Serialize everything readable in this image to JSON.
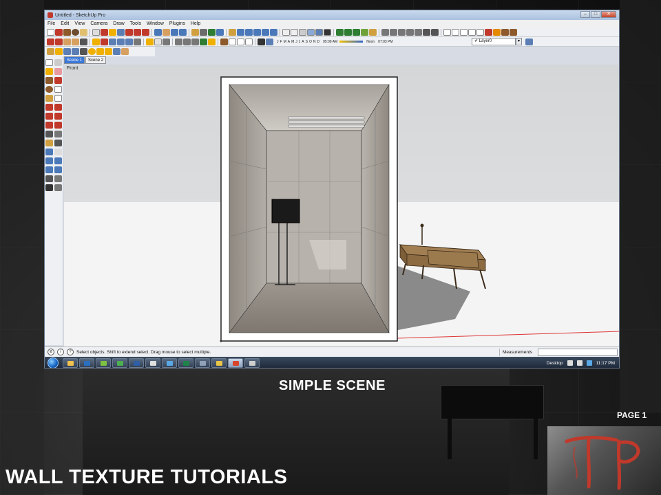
{
  "window": {
    "title": "Untitled - SketchUp Pro",
    "controls": {
      "minimize": "–",
      "maximize": "□",
      "close": "✕"
    }
  },
  "menu": [
    "File",
    "Edit",
    "View",
    "Camera",
    "Draw",
    "Tools",
    "Window",
    "Plugins",
    "Help"
  ],
  "shadow_settings": {
    "months": [
      "J",
      "F",
      "M",
      "A",
      "M",
      "J",
      "J",
      "A",
      "S",
      "O",
      "N",
      "D"
    ],
    "sunrise_time": "05:09 AM",
    "noon_label": "Noon",
    "sunset_time": "07:03 PM"
  },
  "layer": {
    "label": "Layer0",
    "checked": true
  },
  "scene_tabs": [
    {
      "label": "Scene 1",
      "active": true
    },
    {
      "label": "Scene 2",
      "active": false
    }
  ],
  "viewport": {
    "view_label": "Front"
  },
  "status": {
    "hint": "Select objects. Shift to extend select. Drag mouse to select multiple.",
    "measurements_label": "Measurements",
    "measurements_value": ""
  },
  "taskbar": {
    "desktop_label": "Desktop",
    "clock": "11:17 PM",
    "apps": [
      {
        "name": "explorer-icon",
        "color": "#f2c14e"
      },
      {
        "name": "photoshop-icon",
        "color": "#2b6fbf"
      },
      {
        "name": "media-player-icon",
        "color": "#7dc242"
      },
      {
        "name": "utorrent-icon",
        "color": "#4caf50"
      },
      {
        "name": "word-icon",
        "color": "#2f5fa8"
      },
      {
        "name": "paint-icon",
        "color": "#e0e0e0"
      },
      {
        "name": "chat-icon",
        "color": "#5aa9e6"
      },
      {
        "name": "excel-icon",
        "color": "#1e8449"
      },
      {
        "name": "steam-icon",
        "color": "#8fa2b7"
      },
      {
        "name": "chrome-icon",
        "color": "#e8c547"
      },
      {
        "name": "sketchup-icon",
        "color": "#d9452b"
      },
      {
        "name": "archive-icon",
        "color": "#cfcfcf"
      }
    ]
  },
  "poster": {
    "caption": "SIMPLE SCENE",
    "page_label": "PAGE 1",
    "title": "WALL TEXTURE TUTORIALS",
    "logo": "TP",
    "accent_color": "#c0392b"
  }
}
